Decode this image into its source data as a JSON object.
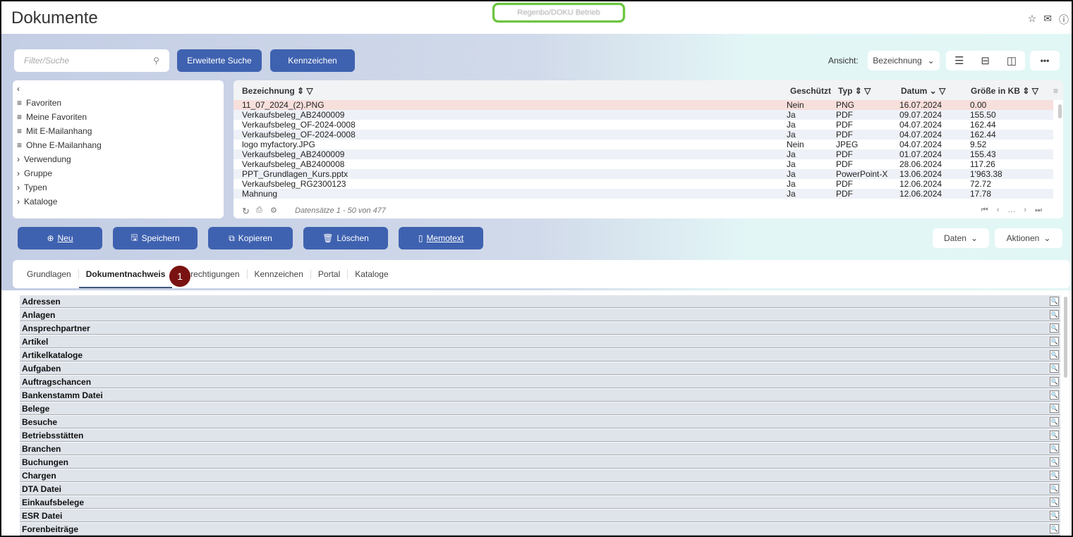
{
  "header": {
    "title": "Dokumente",
    "blurred_label": "Regenbo/DOKU Betrieb"
  },
  "toolbar": {
    "search_placeholder": "Filter/Suche",
    "advanced_search": "Erweiterte Suche",
    "flags": "Kennzeichen",
    "view_label": "Ansicht:",
    "view_value": "Bezeichnung"
  },
  "tree": [
    "Favoriten",
    "Meine Favoriten",
    "Mit E-Mailanhang",
    "Ohne E-Mailanhang",
    "Verwendung",
    "Gruppe",
    "Typen",
    "Kataloge"
  ],
  "grid": {
    "columns": [
      "Bezeichnung",
      "Geschützt",
      "Typ",
      "Datum",
      "Größe in KB"
    ],
    "rows": [
      [
        "11_07_2024_(2).PNG",
        "Nein",
        "PNG",
        "16.07.2024",
        "0.00"
      ],
      [
        "Verkaufsbeleg_AB2400009",
        "Ja",
        "PDF",
        "09.07.2024",
        "155.50"
      ],
      [
        "Verkaufsbeleg_OF-2024-0008",
        "Ja",
        "PDF",
        "04.07.2024",
        "162.44"
      ],
      [
        "Verkaufsbeleg_OF-2024-0008",
        "Ja",
        "PDF",
        "04.07.2024",
        "162.44"
      ],
      [
        "logo myfactory.JPG",
        "Nein",
        "JPEG",
        "04.07.2024",
        "9.52"
      ],
      [
        "Verkaufsbeleg_AB2400009",
        "Ja",
        "PDF",
        "01.07.2024",
        "155.43"
      ],
      [
        "Verkaufsbeleg_AB2400008",
        "Ja",
        "PDF",
        "28.06.2024",
        "117.26"
      ],
      [
        "PPT_Grundlagen_Kurs.pptx",
        "Ja",
        "PowerPoint-X",
        "13.06.2024",
        "1'963.38"
      ],
      [
        "Verkaufsbeleg_RG2300123",
        "Ja",
        "PDF",
        "12.06.2024",
        "72.72"
      ],
      [
        "Mahnung",
        "Ja",
        "PDF",
        "12.06.2024",
        "17.78"
      ]
    ],
    "record_info": "Datensätze 1 - 50 von 477"
  },
  "actions": {
    "new": "Neu",
    "save": "Speichern",
    "copy": "Kopieren",
    "delete": "Löschen",
    "memo": "Memotext",
    "data": "Daten",
    "actions": "Aktionen"
  },
  "tabs": [
    "Grundlagen",
    "Dokumentnachweis",
    "Berechtigungen",
    "Kennzeichen",
    "Portal",
    "Kataloge"
  ],
  "badge": "1",
  "list": [
    "Adressen",
    "Anlagen",
    "Ansprechpartner",
    "Artikel",
    "Artikelkataloge",
    "Aufgaben",
    "Auftragschancen",
    "Bankenstamm Datei",
    "Belege",
    "Besuche",
    "Betriebsstätten",
    "Branchen",
    "Buchungen",
    "Chargen",
    "DTA Datei",
    "Einkaufsbelege",
    "ESR Datei",
    "Forenbeiträge"
  ]
}
